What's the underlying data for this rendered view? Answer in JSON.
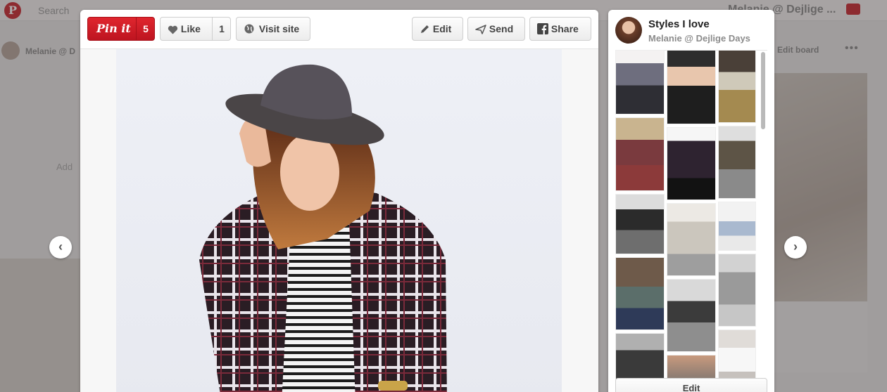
{
  "background": {
    "search_placeholder": "Search",
    "user_name": "Melanie @ D",
    "right_title": "Melanie @ Dejlige ...",
    "edit_board_label": "Edit board",
    "more_label": "•••",
    "add_label": "Add",
    "logo_glyph": "P"
  },
  "toolbar": {
    "pinit_label": "Pin it",
    "pinit_count": "5",
    "like_label": "Like",
    "like_count": "1",
    "visit_label": "Visit site",
    "edit_label": "Edit",
    "send_label": "Send",
    "share_label": "Share"
  },
  "nav": {
    "prev_glyph": "‹",
    "next_glyph": "›"
  },
  "board": {
    "title": "Styles I love",
    "owner": "Melanie @ Dejlige Days",
    "edit_label": "Edit",
    "thumbnail_count": 18
  },
  "colors": {
    "pinit_red": "#cb2027",
    "panel_bg": "#ffffff",
    "overlay": "#8e8a8a"
  },
  "icons": {
    "like": "heart-icon",
    "visit": "globe-icon",
    "edit": "pencil-icon",
    "send": "paper-plane-icon",
    "share": "facebook-icon",
    "prev": "chevron-left-icon",
    "next": "chevron-right-icon"
  }
}
